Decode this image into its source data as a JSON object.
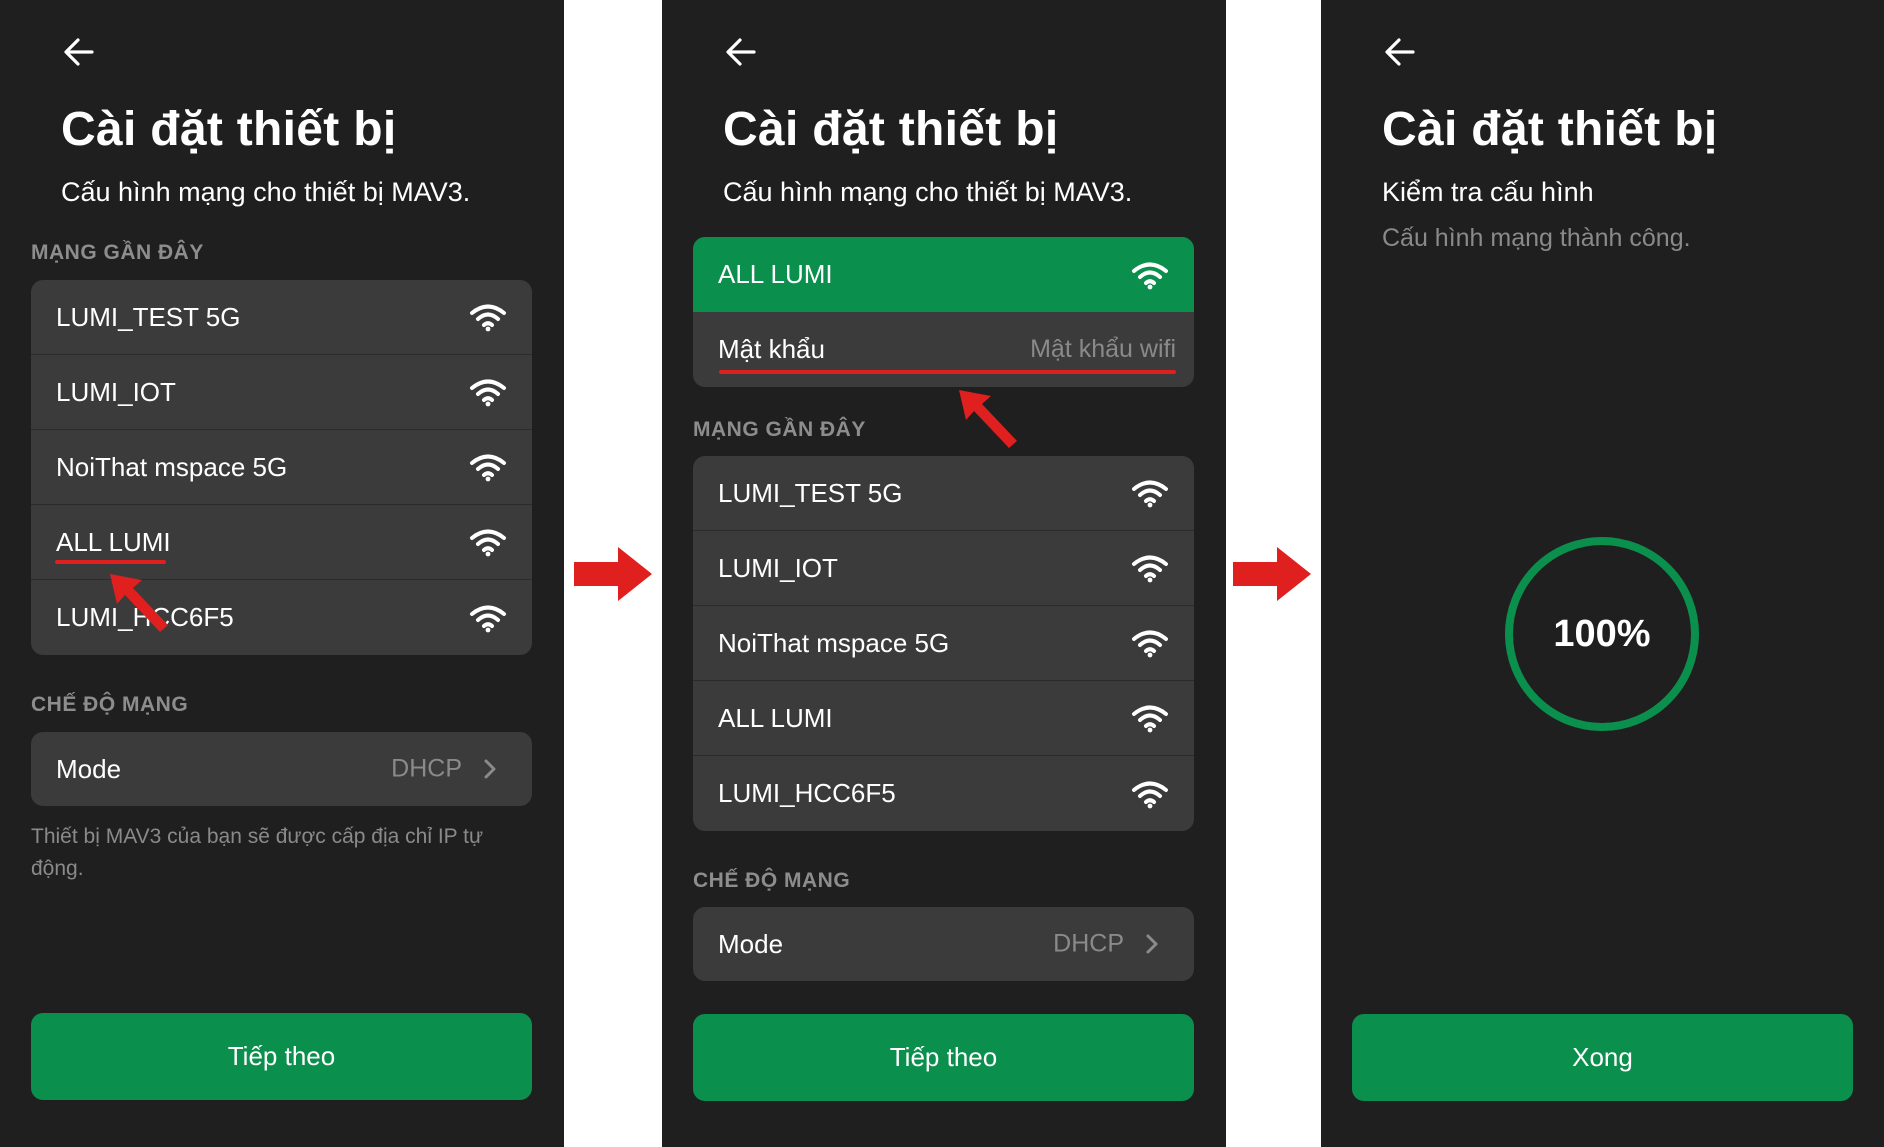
{
  "screens": [
    {
      "title": "Cài đặt thiết bị",
      "subtitle": "Cấu hình mạng cho thiết bị MAV3.",
      "recent_label": "MẠNG GẦN ĐÂY",
      "networks": [
        "LUMI_TEST 5G",
        "LUMI_IOT",
        "NoiThat mspace 5G",
        "ALL LUMI",
        "LUMI_HCC6F5"
      ],
      "mode_section_label": "CHẾ ĐỘ MẠNG",
      "mode_label": "Mode",
      "mode_value": "DHCP",
      "helper_text": "Thiết bị MAV3 của bạn sẽ được cấp địa chỉ IP tự động.",
      "button_label": "Tiếp theo"
    },
    {
      "title": "Cài đặt thiết bị",
      "subtitle": "Cấu hình mạng cho thiết bị MAV3.",
      "selected_network": "ALL LUMI",
      "password_label": "Mật khẩu",
      "password_placeholder": "Mật khẩu wifi",
      "recent_label": "MẠNG GẦN ĐÂY",
      "networks": [
        "LUMI_TEST 5G",
        "LUMI_IOT",
        "NoiThat mspace 5G",
        "ALL LUMI",
        "LUMI_HCC6F5"
      ],
      "mode_section_label": "CHẾ ĐỘ MẠNG",
      "mode_label": "Mode",
      "mode_value": "DHCP",
      "button_label": "Tiếp theo"
    },
    {
      "title": "Cài đặt thiết bị",
      "subtitle": "Kiểm tra cấu hình",
      "status": "Cấu hình mạng thành công.",
      "progress_text": "100%",
      "progress_fraction": 1.0,
      "button_label": "Xong"
    }
  ],
  "icons": {
    "back": "arrow-left-icon",
    "wifi": "wifi-icon",
    "chevron": "chevron-right-icon",
    "flow": "red-arrow-right-icon",
    "pointer": "red-pointer-arrow-icon"
  },
  "colors": {
    "background": "#1f1f1f",
    "card": "#3b3b3c",
    "accent_green": "#0b8f4d",
    "muted_text": "#8a8a8a",
    "highlight_red": "#e01f1f"
  }
}
